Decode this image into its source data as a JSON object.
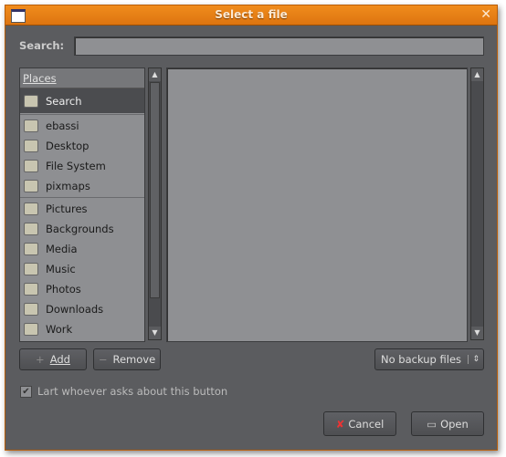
{
  "window": {
    "title": "Select a file"
  },
  "search": {
    "label": "Search:",
    "value": ""
  },
  "places": {
    "header": "Places",
    "items": [
      {
        "label": "Search",
        "icon": "search-icon"
      },
      {
        "label": "ebassi",
        "icon": "home-folder-icon"
      },
      {
        "label": "Desktop",
        "icon": "desktop-icon"
      },
      {
        "label": "File System",
        "icon": "drive-icon"
      },
      {
        "label": "pixmaps",
        "icon": "folder-icon"
      },
      {
        "label": "Pictures",
        "icon": "folder-icon"
      },
      {
        "label": "Backgrounds",
        "icon": "folder-icon"
      },
      {
        "label": "Media",
        "icon": "folder-icon"
      },
      {
        "label": "Music",
        "icon": "folder-icon"
      },
      {
        "label": "Photos",
        "icon": "folder-icon"
      },
      {
        "label": "Downloads",
        "icon": "folder-icon"
      },
      {
        "label": "Work",
        "icon": "folder-icon"
      }
    ]
  },
  "buttons": {
    "add": "Add",
    "remove": "Remove",
    "cancel": "Cancel",
    "open": "Open"
  },
  "filter": {
    "selected": "No backup files"
  },
  "checkbox": {
    "label": "Lart whoever asks about this button",
    "checked": true
  },
  "colors": {
    "titlebar": "#e67f16",
    "body": "#5b5c5f"
  }
}
